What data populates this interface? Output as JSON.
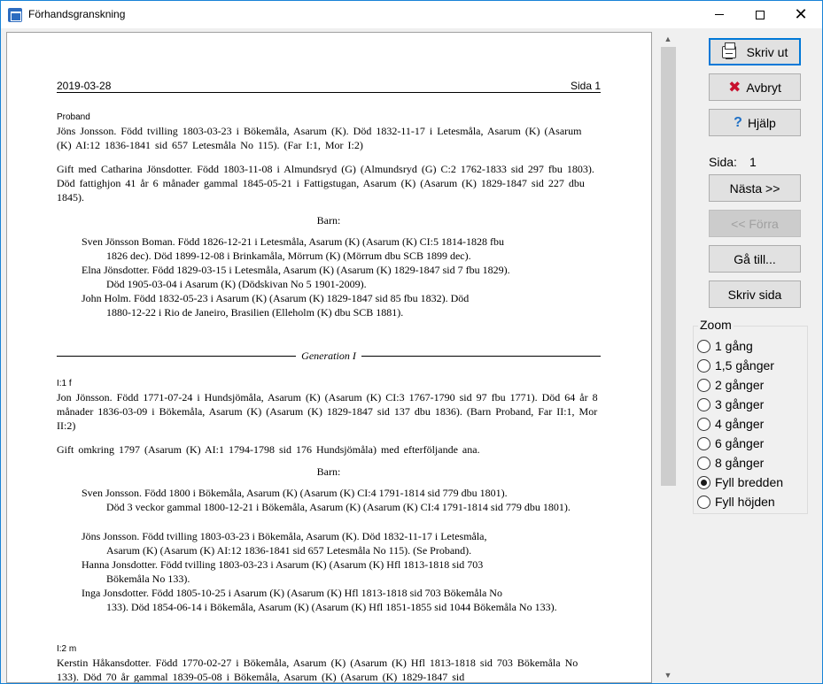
{
  "window": {
    "title": "Förhandsgranskning"
  },
  "page": {
    "date": "2019-03-28",
    "page_label": "Sida 1",
    "proband_label": "Proband",
    "proband_text": "Jöns Jonsson. Född tvilling 1803-03-23 i Bökemåla, Asarum (K). Död 1832-11-17 i Letesmåla, Asarum (K) (Asarum (K) AI:12 1836-1841 sid 657 Letesmåla No 115). (Far I:1, Mor I:2)",
    "married_text": "Gift med Catharina Jönsdotter. Född 1803-11-08 i Almundsryd (G) (Almundsryd (G) C:2 1762-1833 sid 297 fbu 1803). Död fattighjon 41 år 6 månader gammal 1845-05-21 i Fattigstugan, Asarum (K) (Asarum (K) 1829-1847 sid 227 dbu 1845).",
    "children_label": "Barn:",
    "children": [
      {
        "first": "Sven Jönsson Boman. Född 1826-12-21 i Letesmåla, Asarum (K) (Asarum (K) CI:5 1814-1828 fbu",
        "cont": "1826 dec). Död 1899-12-08 i Brinkamåla, Mörrum (K) (Mörrum dbu SCB 1899 dec)."
      },
      {
        "first": "Elna Jönsdotter. Född 1829-03-15 i Letesmåla, Asarum (K) (Asarum (K) 1829-1847 sid 7 fbu 1829).",
        "cont": "Död 1905-03-04 i Asarum (K) (Dödskivan No 5 1901-2009)."
      },
      {
        "first": "John Holm. Född 1832-05-23 i Asarum (K) (Asarum (K) 1829-1847 sid 85 fbu 1832). Död",
        "cont": "1880-12-22 i Rio de Janeiro, Brasilien (Elleholm (K) dbu SCB 1881)."
      }
    ],
    "generation_label": "Generation I",
    "p1_label": "I:1 f",
    "p1_text": "Jon Jönsson. Född 1771-07-24 i Hundsjömåla, Asarum (K) (Asarum (K) CI:3 1767-1790 sid 97 fbu 1771). Död 64 år 8 månader 1836-03-09 i Bökemåla, Asarum (K) (Asarum (K) 1829-1847 sid 137 dbu 1836). (Barn Proband, Far II:1, Mor II:2)",
    "p1_married": "Gift omkring 1797 (Asarum (K) AI:1 1794-1798 sid 176 Hundsjömåla) med efterföljande ana.",
    "children2_label": "Barn:",
    "children2": [
      {
        "first": "Sven Jonsson. Född 1800 i Bökemåla, Asarum (K) (Asarum (K) CI:4 1791-1814 sid 779 dbu 1801).",
        "cont": "Död 3 veckor gammal 1800-12-21 i Bökemåla, Asarum (K) (Asarum (K) CI:4 1791-1814 sid 779 dbu 1801)."
      },
      {
        "first": "Jöns Jonsson. Född tvilling 1803-03-23 i Bökemåla, Asarum (K). Död 1832-11-17 i Letesmåla,",
        "cont": "Asarum (K) (Asarum (K) AI:12 1836-1841 sid 657 Letesmåla No 115). (Se Proband)."
      },
      {
        "first": "Hanna Jonsdotter. Född tvilling 1803-03-23 i Asarum (K) (Asarum (K) Hfl 1813-1818 sid 703",
        "cont": "Bökemåla No 133)."
      },
      {
        "first": "Inga Jonsdotter. Född 1805-10-25 i Asarum (K) (Asarum (K) Hfl 1813-1818 sid 703 Bökemåla No",
        "cont": "133). Död 1854-06-14 i Bökemåla, Asarum (K) (Asarum (K) Hfl 1851-1855 sid 1044 Bökemåla No 133)."
      }
    ],
    "p2_label": "I:2 m",
    "p2_text": "Kerstin Håkansdotter. Född 1770-02-27 i Bökemåla, Asarum (K) (Asarum (K) Hfl 1813-1818 sid 703 Bökemåla No 133). Död 70 år gammal 1839-05-08 i Bökemåla, Asarum (K) (Asarum (K) 1829-1847 sid"
  },
  "buttons": {
    "print": "Skriv ut",
    "cancel": "Avbryt",
    "help": "Hjälp",
    "next": "Nästa >>",
    "prev": "<< Förra",
    "goto": "Gå till...",
    "print_page": "Skriv sida"
  },
  "sida": {
    "label": "Sida:",
    "value": "1"
  },
  "zoom": {
    "legend": "Zoom",
    "options": [
      "1 gång",
      "1,5 gånger",
      "2 gånger",
      "3 gånger",
      "4 gånger",
      "6 gånger",
      "8 gånger",
      "Fyll bredden",
      "Fyll höjden"
    ],
    "selected": "Fyll bredden"
  }
}
